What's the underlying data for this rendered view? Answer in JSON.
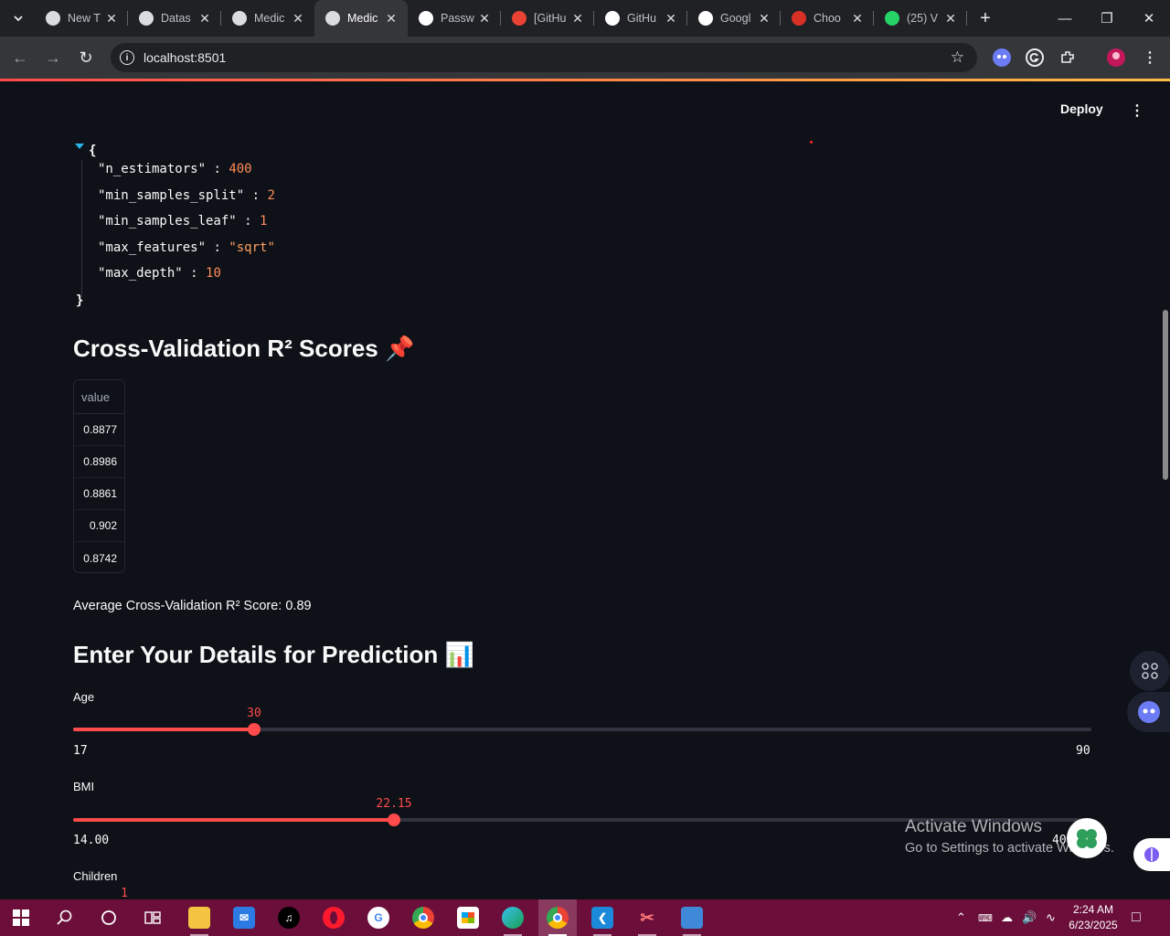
{
  "browser": {
    "tabs": [
      {
        "title": "New T",
        "favicon": "chrome-icon",
        "color": "#dadce0"
      },
      {
        "title": "Datas",
        "favicon": "openai-icon",
        "color": "#dadce0"
      },
      {
        "title": "Medic",
        "favicon": "streamlit-icon",
        "color": "#dadce0"
      },
      {
        "title": "Medic",
        "favicon": "streamlit-icon",
        "color": "#dadce0"
      },
      {
        "title": "Passw",
        "favicon": "github-icon",
        "color": "#ffffff"
      },
      {
        "title": "[GitHu",
        "favicon": "gmail-icon",
        "color": "#ea4335"
      },
      {
        "title": "GitHu",
        "favicon": "github-icon",
        "color": "#ffffff"
      },
      {
        "title": "Googl",
        "favicon": "google-lens-icon",
        "color": "#ffffff"
      },
      {
        "title": "Choo",
        "favicon": "crown-icon",
        "color": "#d93025"
      },
      {
        "title": "(25) V",
        "favicon": "whatsapp-icon",
        "color": "#25d366"
      }
    ],
    "active_tab_index": 3,
    "url": "localhost:8501"
  },
  "app": {
    "deploy_label": "Deploy",
    "json_lines": [
      {
        "key": "\"n_estimators\"",
        "value": "400",
        "type": "num"
      },
      {
        "key": "\"min_samples_split\"",
        "value": "2",
        "type": "num"
      },
      {
        "key": "\"min_samples_leaf\"",
        "value": "1",
        "type": "num"
      },
      {
        "key": "\"max_features\"",
        "value": "\"sqrt\"",
        "type": "str"
      },
      {
        "key": "\"max_depth\"",
        "value": "10",
        "type": "num"
      }
    ],
    "json_open": "{",
    "json_close": "}",
    "cv_heading": "Cross-Validation R² Scores 📌",
    "table": {
      "header": "value",
      "rows": [
        "0.8877",
        "0.8986",
        "0.8861",
        "0.902",
        "0.8742"
      ]
    },
    "avg_text": "Average Cross-Validation R² Score: 0.89",
    "pred_heading": "Enter Your Details for Prediction 📊",
    "sliders": [
      {
        "label": "Age",
        "value": "30",
        "min": "17",
        "max": "90",
        "fraction": 0.178
      },
      {
        "label": "BMI",
        "value": "22.15",
        "min": "14.00",
        "max": "40",
        "fraction": 0.315
      },
      {
        "label": "Children",
        "value": "1",
        "min": "",
        "max": "",
        "fraction": 0.05
      }
    ],
    "activate_windows": {
      "title": "Activate Windows",
      "subtitle": "Go to Settings to activate Windows."
    }
  },
  "taskbar": {
    "time": "2:24 AM",
    "date": "6/23/2025"
  }
}
